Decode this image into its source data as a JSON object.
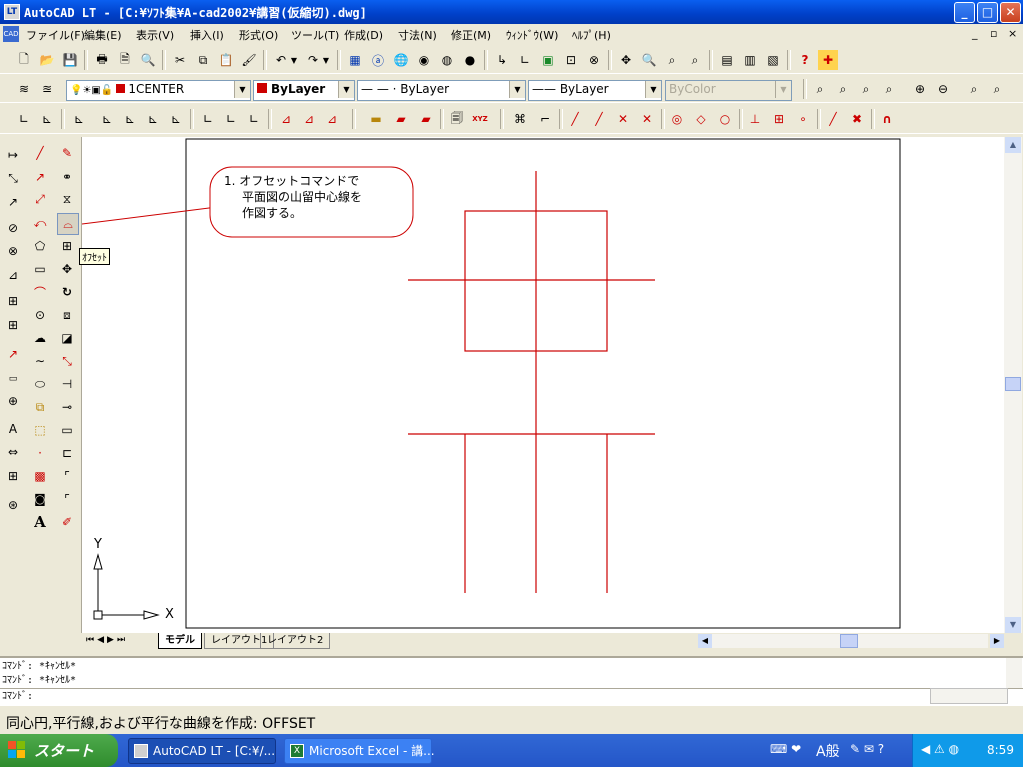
{
  "title_bar": {
    "app_icon": "LT",
    "title": "AutoCAD LT - [C:¥ｿﾌﾄ集¥A-cad2002¥講習(仮縮切).dwg]",
    "buttons": {
      "minimize": "_",
      "maximize": "□",
      "close": "✕"
    }
  },
  "menu": {
    "app_icon": "CAD",
    "items": [
      "ファイル(F)",
      "編集(E)",
      "表示(V)",
      "挿入(I)",
      "形式(O)",
      "ツール(T)",
      "作成(D)",
      "寸法(N)",
      "修正(M)",
      "ｳｨﾝﾄﾞｳ(W)",
      "ﾍﾙﾌﾟ(H)"
    ],
    "mdi_buttons": [
      "_",
      "▫",
      "×"
    ]
  },
  "properties": {
    "layer": "1CENTER",
    "color": "ByLayer",
    "color_swatch": "#cc0000",
    "linetype": "— — · ByLayer",
    "lineweight": "—— ByLayer",
    "plotstyle": "ByColor"
  },
  "tooltip": {
    "label": "ｵﾌｾｯﾄ"
  },
  "callout": {
    "line1": "1. オフセットコマンドで",
    "line2": "平面図の山留中心線を",
    "line3": "作図する。"
  },
  "ucs": {
    "x_label": "X",
    "y_label": "Y"
  },
  "layout_tabs": [
    "モデル",
    "レイアウト1",
    "レイアウト2"
  ],
  "command_line": {
    "lines": [
      "ｺﾏﾝﾄﾞ: *ｷｬﾝｾﾙ*",
      "ｺﾏﾝﾄﾞ: *ｷｬﾝｾﾙ*",
      "ｺﾏﾝﾄﾞ:"
    ]
  },
  "status_bar": {
    "text": "同心円,平行線,および平行な曲線を作成:  OFFSET"
  },
  "taskbar": {
    "start_label": "スタート",
    "tasks": [
      "AutoCAD LT - [C:¥/...",
      "Microsoft Excel - 講..."
    ],
    "ime": "A般",
    "clock": "8:59"
  },
  "colors": {
    "drawing_lines": "#cc0000",
    "xp_blue": "#0a5ff0",
    "start_green": "#3c9a3a"
  },
  "icons": {
    "left_palette_col1": [
      "linear-dim-icon",
      "aligned-dim-icon",
      "radius-icon",
      "diameter-icon",
      "angular-icon",
      "baseline-icon",
      "continue-icon",
      "leader-icon",
      "tolerance-icon",
      "center-mark-icon",
      "dimedit-icon",
      "dimtedit-icon",
      "update-icon",
      "dimstyle-icon",
      "ordinate-icon"
    ],
    "left_palette_col2": [
      "line-icon",
      "ray-icon",
      "xline-icon",
      "polyline-icon",
      "polygon-icon",
      "rectangle-icon",
      "arc-icon",
      "circle-icon",
      "revcloud-icon",
      "spline-icon",
      "ellipse-icon",
      "insert-block-icon",
      "make-block-icon",
      "point-icon",
      "hatch-icon",
      "region-icon",
      "text-icon"
    ],
    "left_palette_col3": [
      "erase-icon",
      "copy-icon",
      "mirror-icon",
      "offset-icon",
      "array-icon",
      "move-icon",
      "rotate-icon",
      "scale-icon",
      "stretch-icon",
      "lengthen-icon",
      "trim-icon",
      "extend-icon",
      "break-icon",
      "join-icon",
      "chamfer-icon",
      "fillet-icon",
      "explode-icon"
    ]
  }
}
